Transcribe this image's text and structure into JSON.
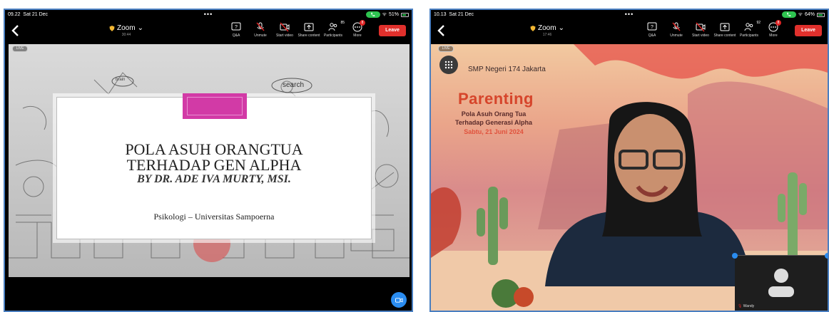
{
  "left": {
    "status": {
      "time": "09.22",
      "date": "Sat 21 Dec",
      "battery": "51%",
      "battery_level": 0.51
    },
    "meeting": {
      "title": "Zoom",
      "duration": "30:44"
    },
    "toolbar": {
      "qa": "Q&A",
      "unmute": "Unmute",
      "start_video": "Start video",
      "share": "Share content",
      "participants": "Participants",
      "participants_count": "85",
      "more": "More",
      "more_badge": "8",
      "leave": "Leave"
    },
    "live": "LIVE",
    "slide": {
      "title_line1": "POLA ASUH ORANGTUA",
      "title_line2": "TERHADAP GEN ALPHA",
      "author": "BY DR. ADE IVA MURTY, MSI.",
      "affiliation": "Psikologi – Universitas Sampoerna",
      "sketch_words": [
        "search",
        "brain"
      ]
    }
  },
  "right": {
    "status": {
      "time": "10.13",
      "date": "Sat 21 Dec",
      "battery": "64%",
      "battery_level": 0.64
    },
    "meeting": {
      "title": "Zoom",
      "duration": "17:46"
    },
    "toolbar": {
      "qa": "Q&A",
      "unmute": "Unmute",
      "start_video": "Start video",
      "share": "Share content",
      "participants": "Participants",
      "participants_count": "92",
      "more": "More",
      "more_badge": "8",
      "leave": "Leave"
    },
    "live": "LIVE",
    "background": {
      "school": "SMP Negeri 174 Jakarta",
      "event": "Parenting",
      "subtitle_line1": "Pola Asuh Orang Tua",
      "subtitle_line2": "Terhadap Generasi Alpha",
      "date": "Sabtu, 21 Juni 2024"
    },
    "self_view": {
      "name": "Wandy"
    }
  },
  "colors": {
    "leave": "#e0302c",
    "frame_border": "#4a7fc1",
    "accent_blue": "#2a8cf0",
    "slide_tape": "#d23aa6",
    "parenting": "#d6452b"
  }
}
